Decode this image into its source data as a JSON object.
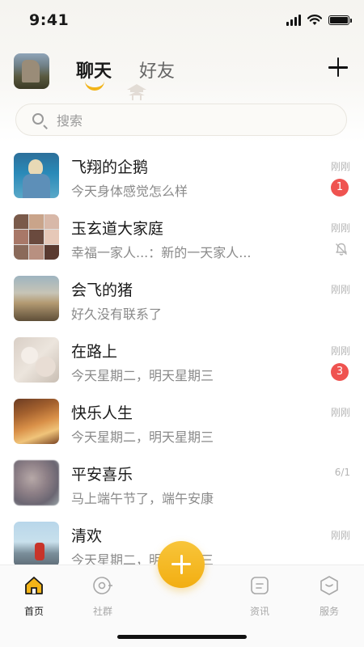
{
  "status_bar": {
    "time": "9:41"
  },
  "header": {
    "tabs": [
      {
        "label": "聊天",
        "active": true
      },
      {
        "label": "好友",
        "active": false
      }
    ]
  },
  "search": {
    "placeholder": "搜索"
  },
  "chats": [
    {
      "name": "飞翔的企鹅",
      "message": "今天身体感觉怎么样",
      "time": "刚刚",
      "badge": "1"
    },
    {
      "name": "玉玄道大家庭",
      "message": "幸福一家人...：新的一天家人...",
      "time": "刚刚",
      "muted": true
    },
    {
      "name": "会飞的猪",
      "message": "好久没有联系了",
      "time": "刚刚"
    },
    {
      "name": "在路上",
      "message": "今天星期二，明天星期三",
      "time": "刚刚",
      "badge": "3"
    },
    {
      "name": "快乐人生",
      "message": "今天星期二，明天星期三",
      "time": "刚刚"
    },
    {
      "name": "平安喜乐",
      "message": "马上端午节了，端午安康",
      "time": "6/1"
    },
    {
      "name": "清欢",
      "message": "今天星期二，明天星期三",
      "time": "刚刚"
    }
  ],
  "tabbar": {
    "items": [
      {
        "label": "首页",
        "icon": "home-icon",
        "active": true
      },
      {
        "label": "社群",
        "icon": "community-icon",
        "active": false
      },
      {
        "label": "资讯",
        "icon": "news-icon",
        "active": false
      },
      {
        "label": "服务",
        "icon": "service-icon",
        "active": false
      }
    ]
  },
  "colors": {
    "accent": "#F2B418",
    "badge": "#EF5350"
  }
}
